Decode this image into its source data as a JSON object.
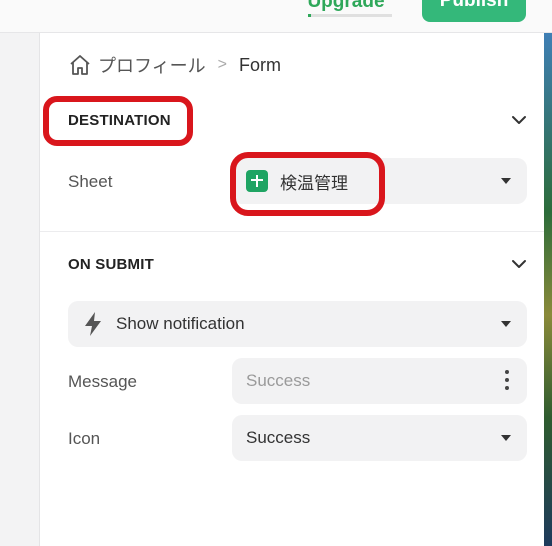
{
  "topbar": {
    "upgrade_label": "Upgrade",
    "publish_label": "Publish",
    "publish_color": "#34b87a"
  },
  "breadcrumb": {
    "home_icon": "home-icon",
    "parent": "プロフィール",
    "separator": ">",
    "current": "Form"
  },
  "destination": {
    "title": "DESTINATION",
    "sheet_label": "Sheet",
    "sheet_value": "検温管理",
    "sheet_icon": "google-sheets-icon",
    "annotation_color": "#d9161c"
  },
  "on_submit": {
    "title": "ON SUBMIT",
    "action_icon": "lightning-icon",
    "action_value": "Show notification",
    "message_label": "Message",
    "message_placeholder": "Success",
    "icon_label": "Icon",
    "icon_value": "Success"
  }
}
